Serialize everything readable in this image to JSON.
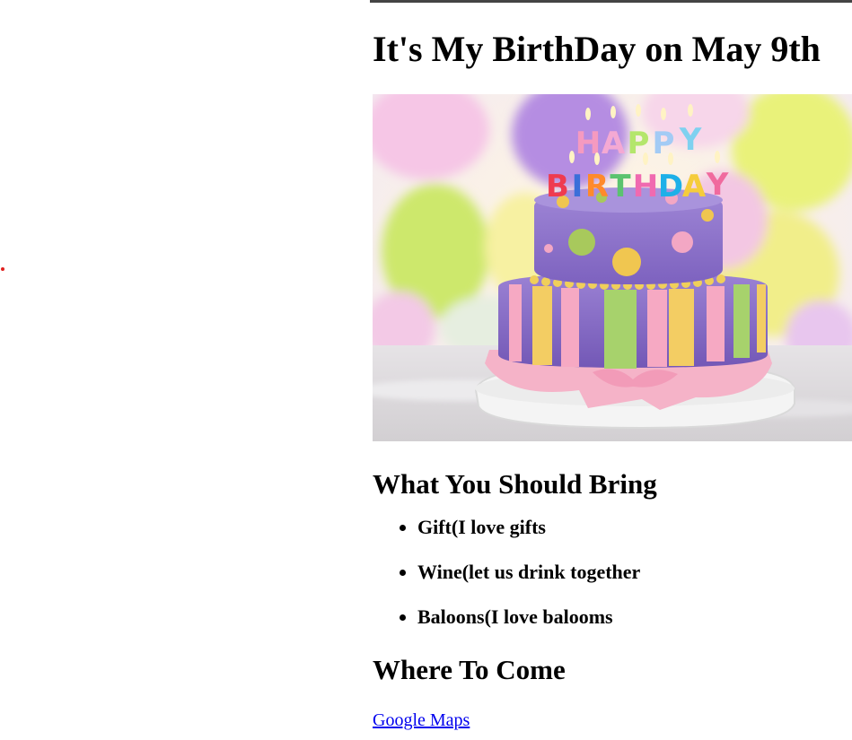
{
  "heading": "It's My BirthDay on May 9th",
  "image": {
    "alt": "Birthday cake with Happy Birthday candles",
    "candle_text_line1": "HAPPY",
    "candle_text_line2": "BIRTHDAY"
  },
  "bring": {
    "title": "What You Should Bring",
    "items": [
      "Gift(I love gifts",
      "Wine(let us drink together",
      "Baloons(I love balooms"
    ]
  },
  "where": {
    "title": "Where To Come",
    "link_label": "Google Maps"
  },
  "colors": {
    "link": "#0000ee",
    "dot": "#e0201e"
  }
}
